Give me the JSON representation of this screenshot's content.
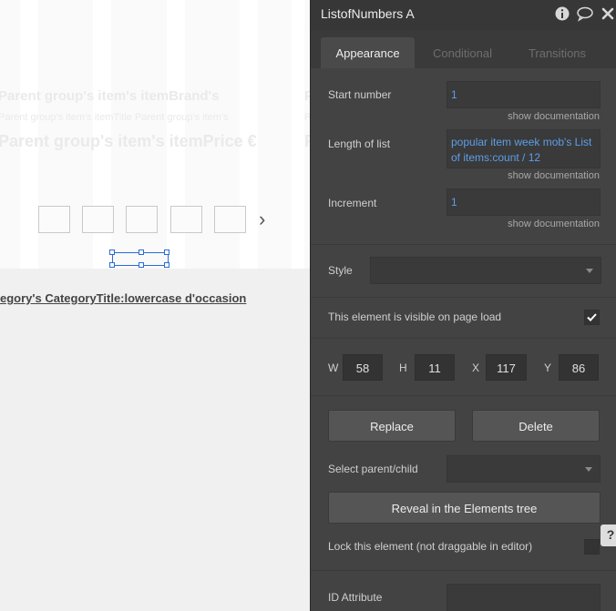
{
  "canvas": {
    "repeating_cards": [
      {
        "brand": "Parent group's item's itemBrand's",
        "title": "Parent group's item's itemTitle Parent group's item's",
        "price": "Parent group's item's itemPrice €"
      },
      {
        "brand": "P",
        "title": "P",
        "price": "P"
      }
    ],
    "pagination_dots": 5,
    "next_arrow": "›",
    "category_link": "egory's CategoryTitle:lowercase d'occasion"
  },
  "panel": {
    "title": "ListofNumbers A",
    "header_icons": [
      "info-icon",
      "comment-icon",
      "close-icon"
    ],
    "tabs": [
      {
        "label": "Appearance",
        "active": true
      },
      {
        "label": "Conditional",
        "active": false
      },
      {
        "label": "Transitions",
        "active": false
      }
    ],
    "start_number": {
      "label": "Start number",
      "value": "1",
      "doc": "show documentation"
    },
    "length_of_list": {
      "label": "Length of list",
      "value": "popular item week mob's List of items:count / 12",
      "doc": "show documentation"
    },
    "increment": {
      "label": "Increment",
      "value": "1",
      "doc": "show documentation"
    },
    "style": {
      "label": "Style",
      "value": ""
    },
    "visible_on_load": {
      "label": "This element is visible on page load",
      "checked": true
    },
    "dimensions": {
      "w_label": "W",
      "w": "58",
      "h_label": "H",
      "h": "11",
      "x_label": "X",
      "x": "117",
      "y_label": "Y",
      "y": "86"
    },
    "replace_label": "Replace",
    "delete_label": "Delete",
    "select_parent": {
      "label": "Select parent/child",
      "value": ""
    },
    "reveal_label": "Reveal in the Elements tree",
    "lock": {
      "label": "Lock this element (not draggable in editor)",
      "checked": false
    },
    "id_attribute": {
      "label": "ID Attribute",
      "value": ""
    },
    "help_label": "?"
  },
  "colors": {
    "panel_bg": "#434343",
    "header_bg": "#373737",
    "field_text": "#5d9ee8",
    "selection_blue": "#2a6bd8"
  }
}
